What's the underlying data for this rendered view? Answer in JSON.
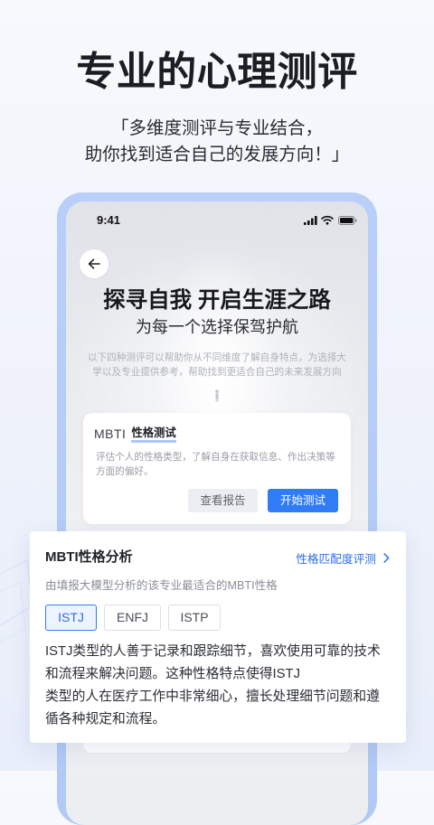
{
  "hero": {
    "title": "专业的心理测评",
    "subtitle_lines": [
      "「多维度测评与专业结合，",
      "助你找到适合自己的发展方向！」"
    ]
  },
  "phone": {
    "status_time": "9:41",
    "heading": "探寻自我 开启生涯之路",
    "subheading": "为每一个选择保驾护航",
    "intro_lines": [
      "以下四种测评可以帮助你从不同维度了解自身特点，为选择大",
      "学以及专业提供参考，帮助找到更适合自己的未来发展方向"
    ],
    "test_card": {
      "brand": "MBTI",
      "title": "性格测试",
      "description_lines": [
        "评估个人的性格类型，了解自身在获取信息、作出决策等",
        "方面的偏好。"
      ],
      "report_button": "查看报告",
      "start_button": "开始测试"
    }
  },
  "analysis": {
    "title": "MBTI性格分析",
    "link_label": "性格匹配度评测",
    "caption": "由填报大模型分析的该专业最适合的MBTI性格",
    "types": [
      {
        "label": "ISTJ",
        "selected": true
      },
      {
        "label": "ENFJ",
        "selected": false
      },
      {
        "label": "ISTP",
        "selected": false
      }
    ],
    "paragraph_lines": [
      "ISTJ类型的人善于记录和跟踪细节，喜欢使用可靠的技术",
      "和流程来解决问题。这种性格特点使得ISTJ",
      "类型的人在医疗工作中非常细心，擅长处理细节问题和遵",
      "循各种规定和流程。"
    ]
  },
  "icons": {
    "back": "back-arrow-icon",
    "signal": "signal-icon",
    "wifi": "wifi-icon",
    "battery": "battery-icon",
    "link_chevron": "chevron-right-icon",
    "figure": "person-figure-icon"
  },
  "colors": {
    "accent": "#2f7cf6",
    "link": "#2b6fe8",
    "frame": "#b0c9f5"
  }
}
